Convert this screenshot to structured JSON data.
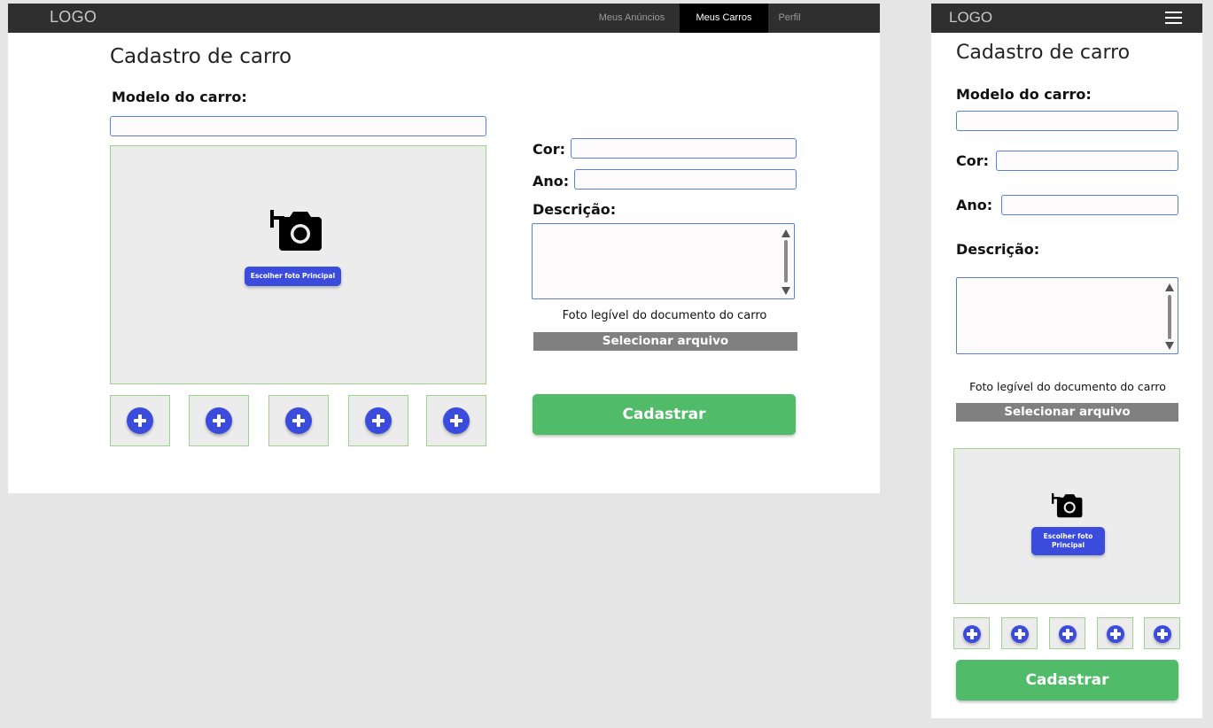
{
  "desktop": {
    "nav": {
      "logo": "LOGO",
      "items": [
        "Meus Anúncios",
        "Meus Carros",
        "Perfil"
      ],
      "active_item": "Meus Carros"
    },
    "page_title": "Cadastro de carro",
    "modelo_label": "Modelo do carro:",
    "cor_label": "Cor:",
    "ano_label": "Ano:",
    "descricao_label": "Descrição:",
    "main_photo_button": "Escolher foto Principal",
    "document_label": "Foto legível do documento do carro",
    "select_file_button": "Selecionar arquivo",
    "submit_button": "Cadastrar"
  },
  "mobile": {
    "nav": {
      "logo": "LOGO",
      "menu_icon": "hamburger-menu-icon"
    },
    "page_title": "Cadastro de carro",
    "modelo_label": "Modelo do carro:",
    "cor_label": "Cor:",
    "ano_label": "Ano:",
    "descricao_label": "Descrição:",
    "document_label": "Foto legível do documento do carro",
    "select_file_button": "Selecionar arquivo",
    "main_photo_button": "Escolher foto Principal",
    "submit_button": "Cadastrar"
  },
  "icons": {
    "camera": "add-photo-camera-icon",
    "thumb_add": "plus-circle-icon"
  },
  "colors": {
    "nav_bg": "#2f2f2f",
    "active_nav_bg": "#000000",
    "primary_blue": "#3b4bdc",
    "input_border": "#5a7fd6",
    "photo_border": "#9ed38f",
    "photo_bg": "#ececec",
    "file_button_bg": "#808080",
    "submit_green": "#50bb68"
  }
}
